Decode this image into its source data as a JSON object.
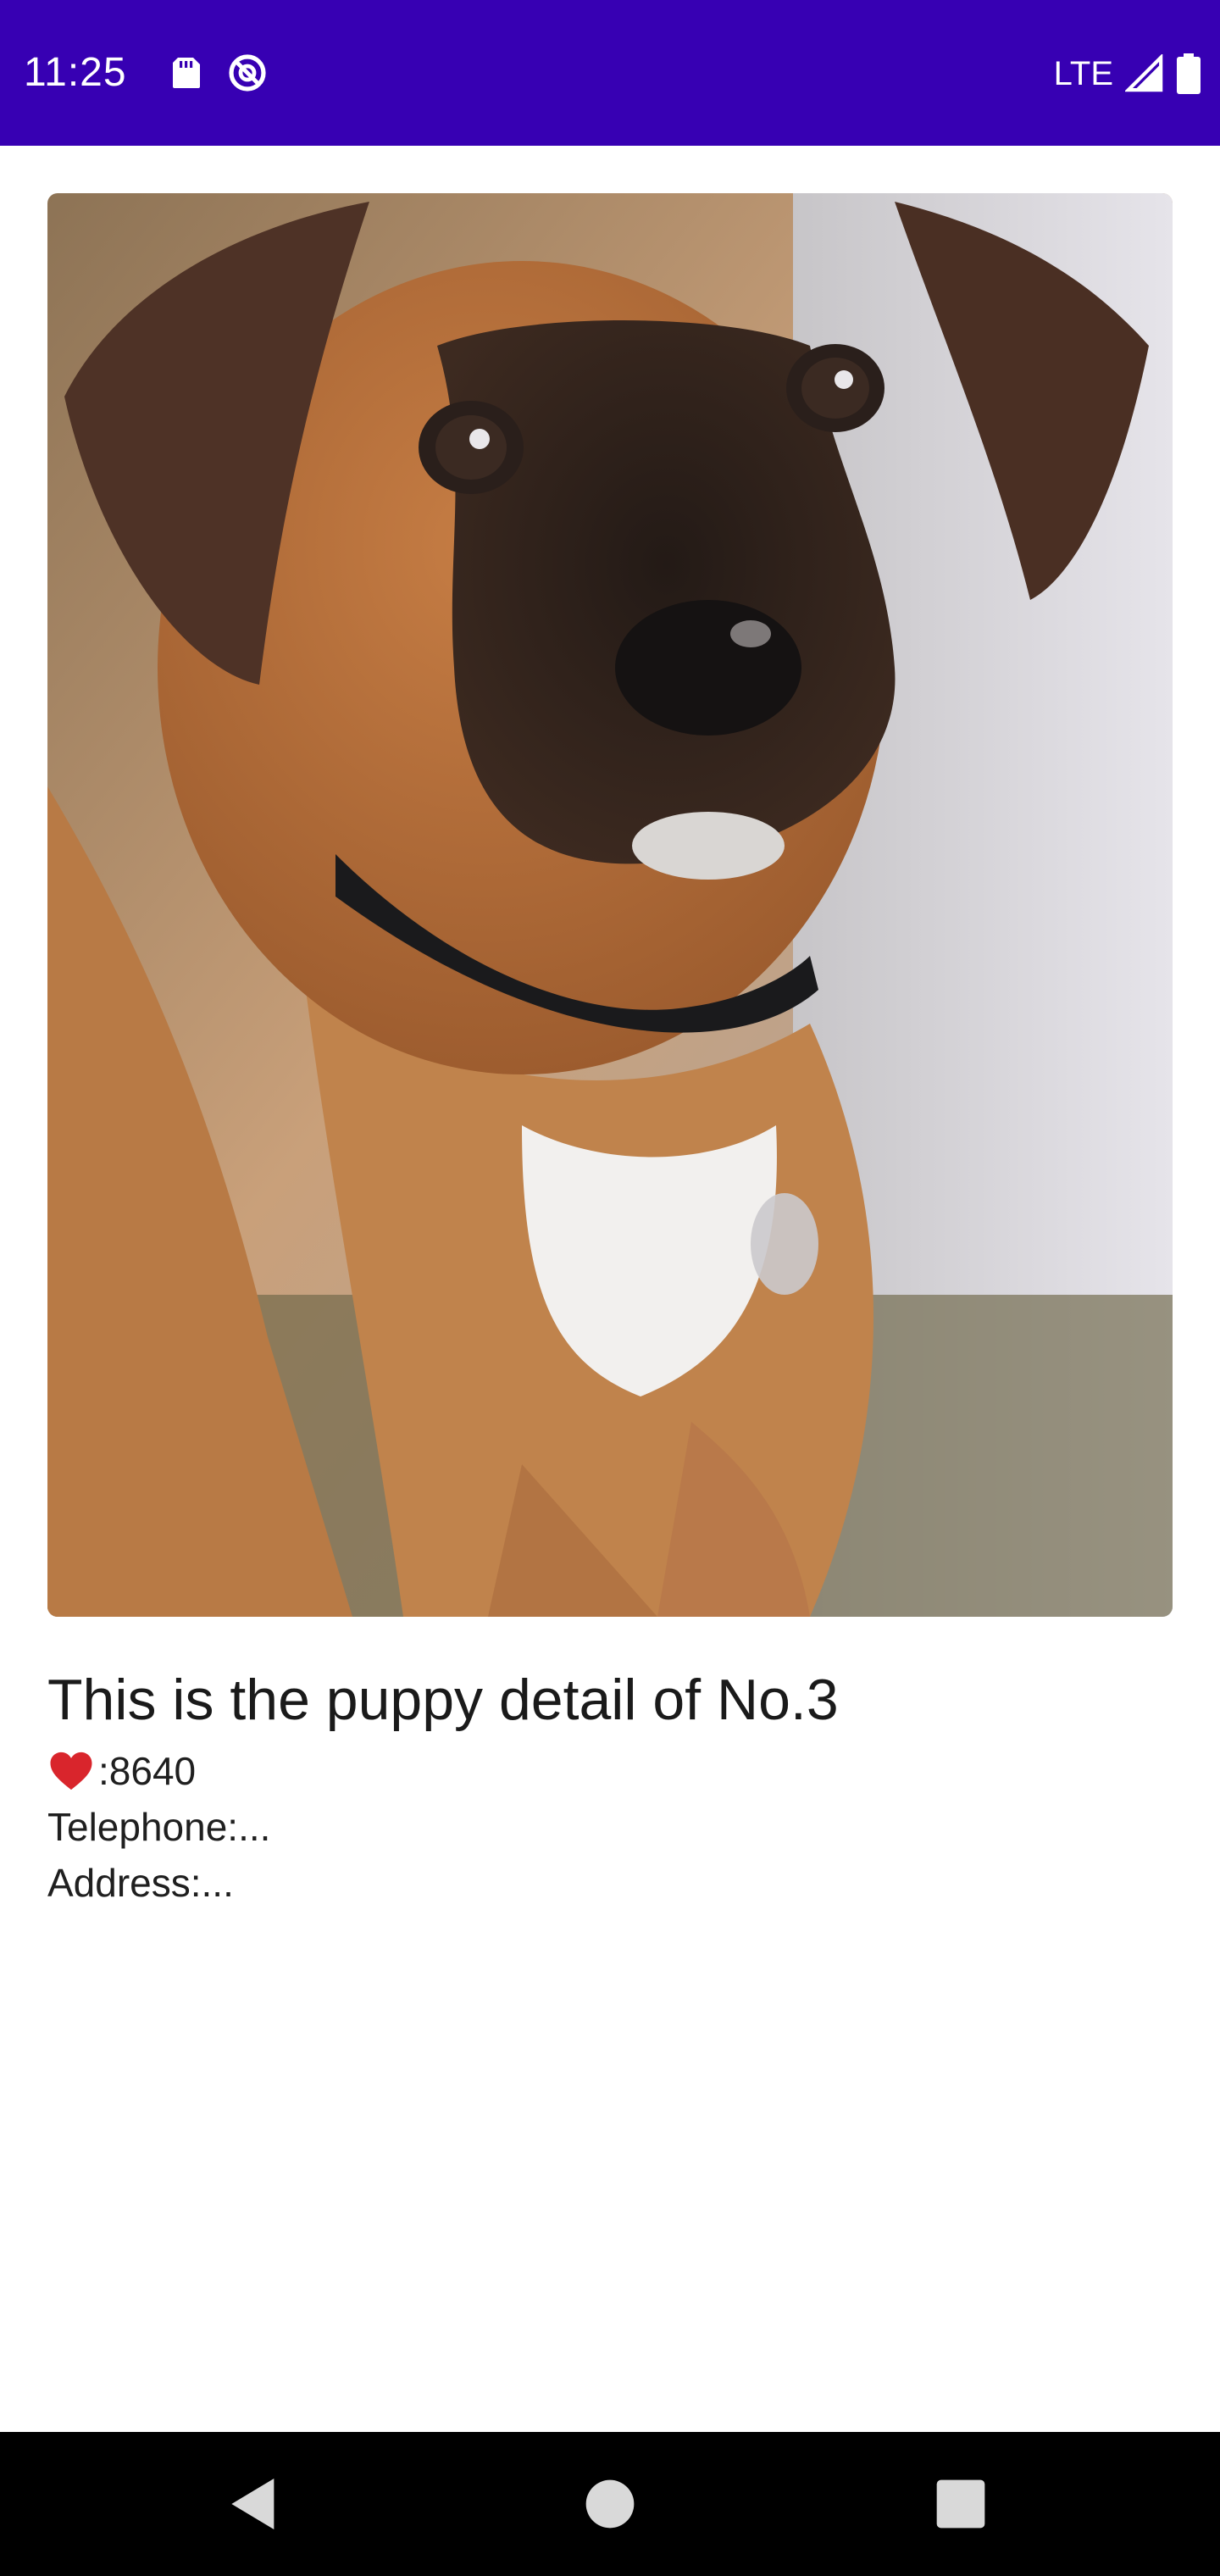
{
  "status_bar": {
    "time": "11:25",
    "network_label": "LTE",
    "icons": [
      "sd-card-icon",
      "at-sign-icon",
      "signal-icon",
      "battery-icon"
    ],
    "background_color": "#3700b3"
  },
  "detail": {
    "image_alt": "puppy photo",
    "title": "This is the puppy detail of No.3",
    "likes_icon": "heart-icon",
    "likes_text": ":8640",
    "telephone": "Telephone:...",
    "address": "Address:..."
  },
  "nav_bar": {
    "buttons": [
      "back-icon",
      "home-icon",
      "recents-icon"
    ]
  }
}
